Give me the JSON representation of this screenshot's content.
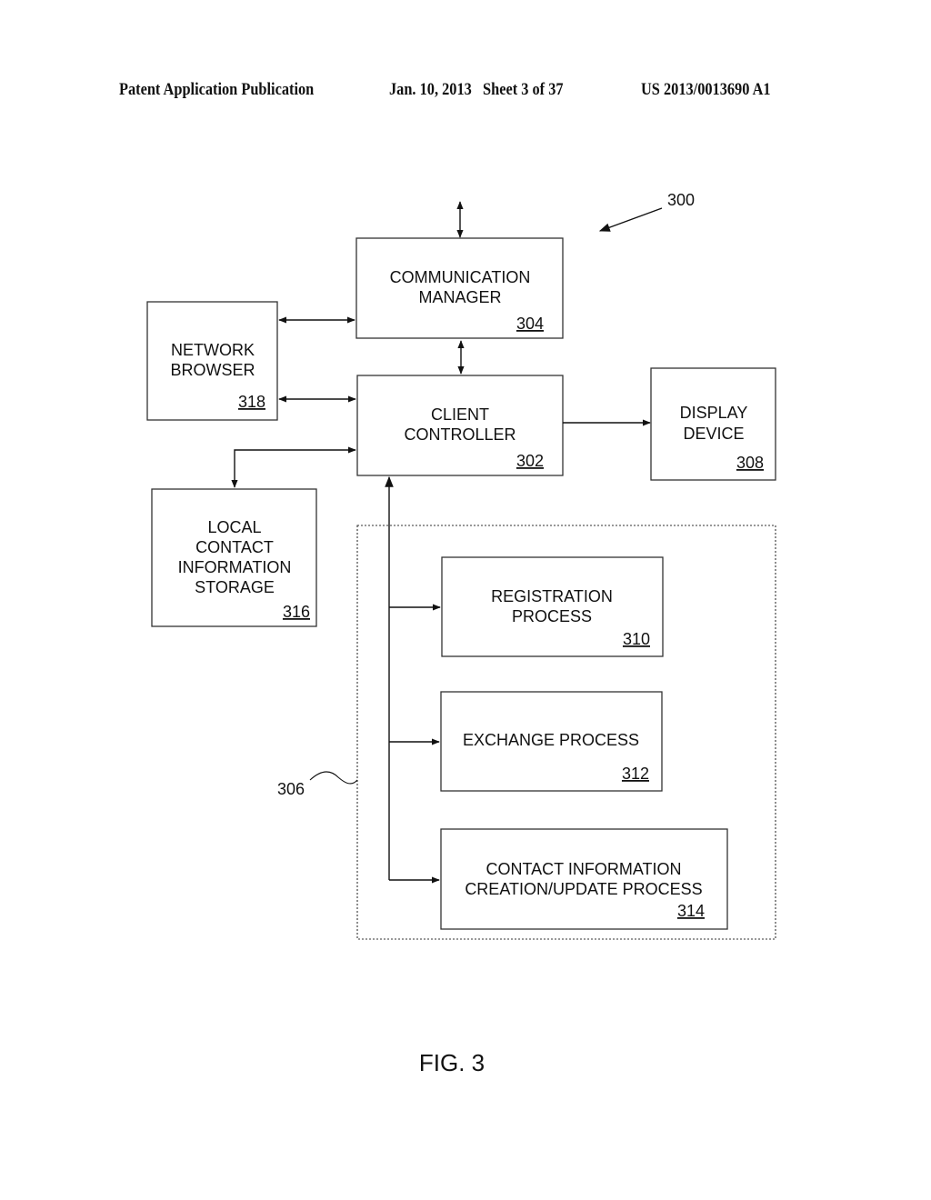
{
  "header": {
    "publication": "Patent Application Publication",
    "date_sheet": "Jan. 10, 2013   Sheet 3 of 37",
    "patent_number": "US 2013/0013690 A1"
  },
  "figure": {
    "caption": "FIG. 3",
    "system_ref": "300",
    "group_ref": "306",
    "blocks": {
      "communication_manager": {
        "lines": [
          "COMMUNICATION",
          "MANAGER"
        ],
        "ref": "304"
      },
      "network_browser": {
        "lines": [
          "NETWORK",
          "BROWSER"
        ],
        "ref": "318"
      },
      "client_controller": {
        "lines": [
          "CLIENT",
          "CONTROLLER"
        ],
        "ref": "302"
      },
      "display_device": {
        "lines": [
          "DISPLAY",
          "DEVICE"
        ],
        "ref": "308"
      },
      "local_storage": {
        "lines": [
          "LOCAL",
          "CONTACT",
          "INFORMATION",
          "STORAGE"
        ],
        "ref": "316"
      },
      "registration_process": {
        "lines": [
          "REGISTRATION",
          "PROCESS"
        ],
        "ref": "310"
      },
      "exchange_process": {
        "lines": [
          "EXCHANGE PROCESS"
        ],
        "ref": "312"
      },
      "creation_update_process": {
        "lines": [
          "CONTACT INFORMATION",
          "CREATION/UPDATE PROCESS"
        ],
        "ref": "314"
      }
    },
    "connections": [
      {
        "from": "external",
        "to": "communication_manager",
        "direction": "bidirectional"
      },
      {
        "from": "network_browser",
        "to": "communication_manager",
        "direction": "bidirectional"
      },
      {
        "from": "communication_manager",
        "to": "client_controller",
        "direction": "bidirectional"
      },
      {
        "from": "network_browser",
        "to": "client_controller",
        "direction": "bidirectional"
      },
      {
        "from": "client_controller",
        "to": "display_device",
        "direction": "forward"
      },
      {
        "from": "client_controller",
        "to": "local_storage",
        "direction": "bidirectional"
      },
      {
        "from": "client_controller",
        "to": "registration_process",
        "direction": "bidirectional"
      },
      {
        "from": "client_controller",
        "to": "exchange_process",
        "direction": "bidirectional"
      },
      {
        "from": "client_controller",
        "to": "creation_update_process",
        "direction": "bidirectional"
      }
    ]
  }
}
